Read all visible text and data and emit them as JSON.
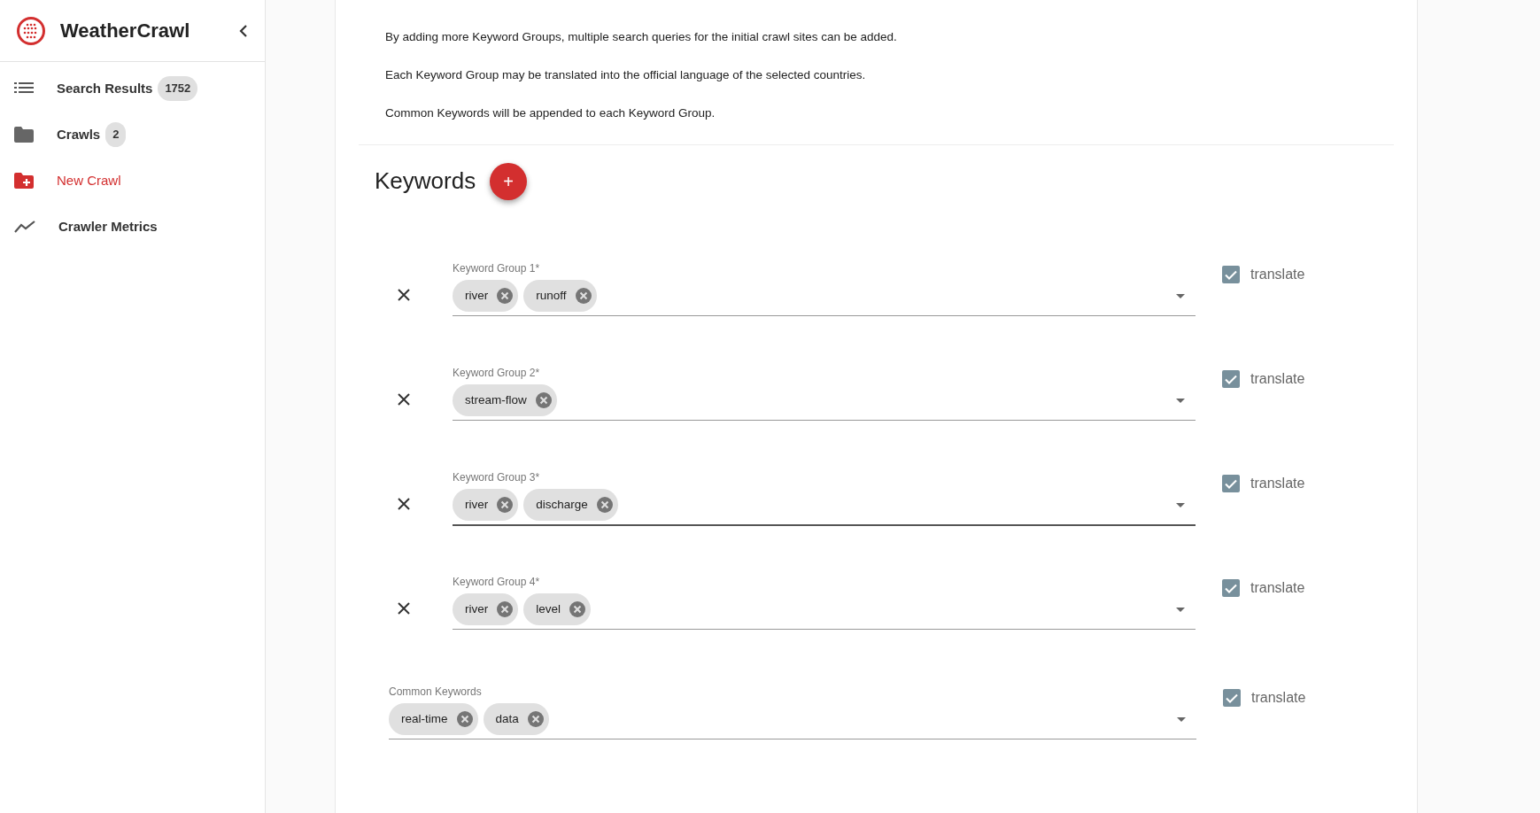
{
  "app": {
    "title": "WeatherCrawl"
  },
  "sidebar": {
    "items": [
      {
        "kind": "list",
        "label": "Search Results",
        "count": "1752",
        "selected": false
      },
      {
        "kind": "folder",
        "label": "Crawls",
        "count": "2",
        "selected": false
      },
      {
        "kind": "new-folder",
        "label": "New Crawl",
        "selected": true
      },
      {
        "kind": "metrics",
        "label": "Crawler Metrics",
        "selected": false
      }
    ]
  },
  "intro": [
    "By adding more Keyword Groups, multiple search queries for the initial crawl sites can be added.",
    "Each Keyword Group may be translated into the official language of the selected countries.",
    "Common Keywords will be appended to each Keyword Group."
  ],
  "keywords": {
    "heading": "Keywords",
    "add_button": "+",
    "groups": [
      {
        "label": "Keyword Group 1*",
        "chips": [
          "river",
          "runoff"
        ],
        "focused": false,
        "translate": {
          "label": "translate",
          "checked": true
        }
      },
      {
        "label": "Keyword Group 2*",
        "chips": [
          "stream-flow"
        ],
        "focused": false,
        "translate": {
          "label": "translate",
          "checked": true
        }
      },
      {
        "label": "Keyword Group 3*",
        "chips": [
          "river",
          "discharge"
        ],
        "focused": true,
        "translate": {
          "label": "translate",
          "checked": true
        }
      },
      {
        "label": "Keyword Group 4*",
        "chips": [
          "river",
          "level"
        ],
        "focused": false,
        "translate": {
          "label": "translate",
          "checked": true
        }
      }
    ],
    "common": {
      "label": "Common Keywords",
      "chips": [
        "real-time",
        "data"
      ],
      "focused": false,
      "translate": {
        "label": "translate",
        "checked": true
      }
    }
  }
}
